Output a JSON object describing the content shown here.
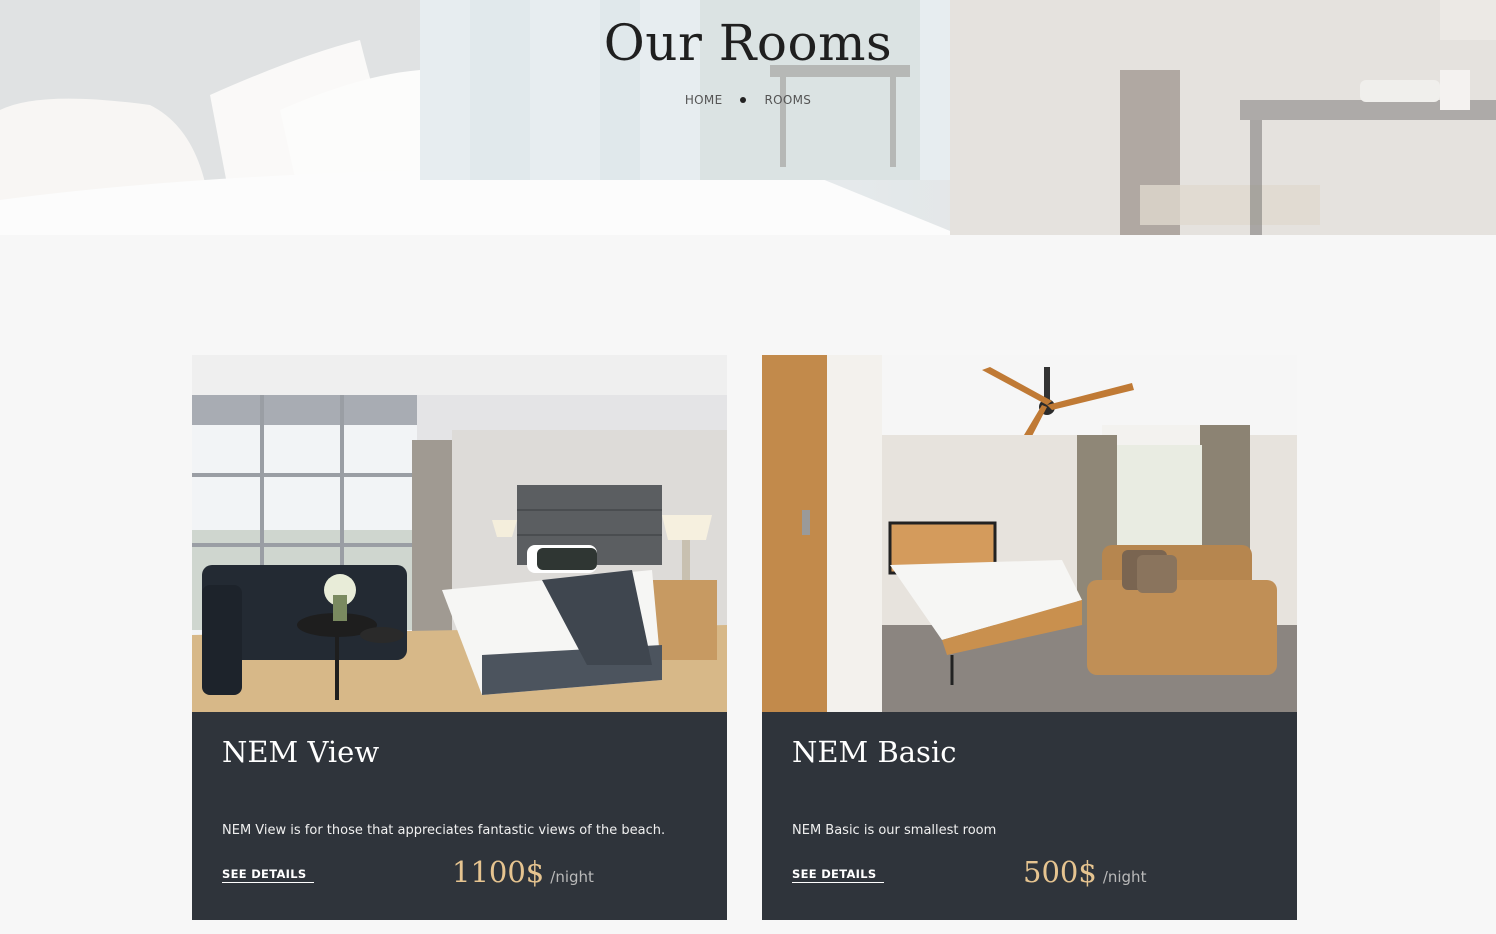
{
  "hero": {
    "title": "Our Rooms",
    "breadcrumb": [
      "HOME",
      "ROOMS"
    ]
  },
  "rooms": [
    {
      "name": "NEM View",
      "description": "NEM View is for those that appreciates fantastic views of the beach.",
      "link_label": "SEE DETAILS",
      "price": "1100$",
      "unit": "/night"
    },
    {
      "name": "NEM Basic",
      "description": "NEM Basic is our smallest room",
      "link_label": "SEE DETAILS",
      "price": "500$",
      "unit": "/night"
    }
  ],
  "colors": {
    "card_bg": "#2f343b",
    "price": "#e6c490",
    "page_bg": "#f7f7f7"
  }
}
